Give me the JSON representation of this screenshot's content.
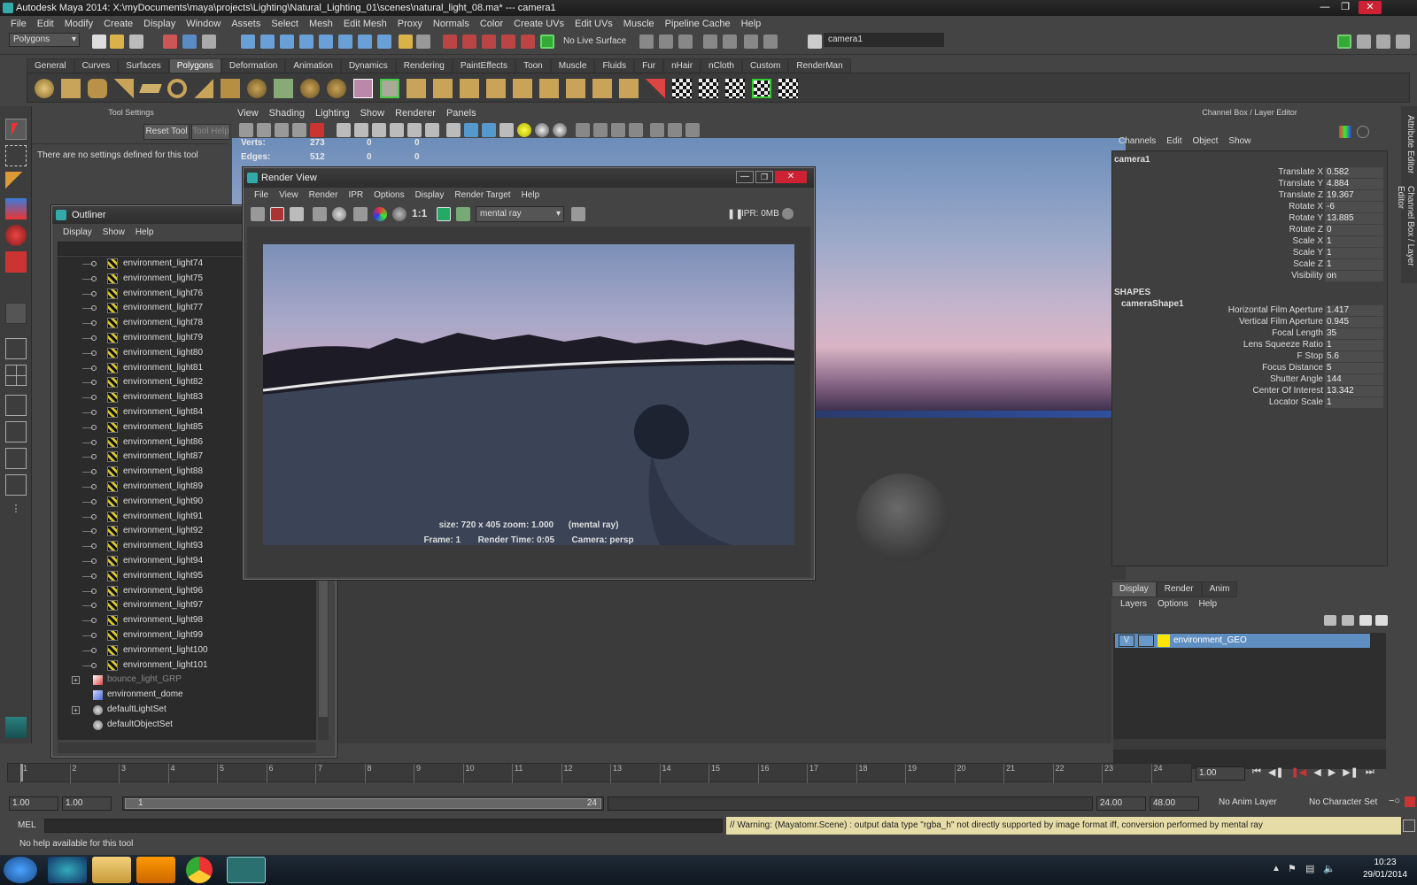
{
  "app": {
    "title": "Autodesk Maya 2014: X:\\myDocuments\\maya\\projects\\Lighting\\Natural_Lighting_01\\scenes\\natural_light_08.ma*   ---   camera1",
    "menus": [
      "File",
      "Edit",
      "Modify",
      "Create",
      "Display",
      "Window",
      "Assets",
      "Select",
      "Mesh",
      "Edit Mesh",
      "Proxy",
      "Normals",
      "Color",
      "Create UVs",
      "Edit UVs",
      "Muscle",
      "Pipeline Cache",
      "Help"
    ]
  },
  "statusline": {
    "menuset": "Polygons",
    "live_surface": "No Live Surface",
    "camera_field": "camera1"
  },
  "shelf": {
    "tabs": [
      "General",
      "Curves",
      "Surfaces",
      "Polygons",
      "Deformation",
      "Animation",
      "Dynamics",
      "Rendering",
      "PaintEffects",
      "Toon",
      "Muscle",
      "Fluids",
      "Fur",
      "nHair",
      "nCloth",
      "Custom",
      "RenderMan"
    ],
    "active_tab": "Polygons"
  },
  "tool_settings": {
    "header": "Tool Settings",
    "reset_label": "Reset Tool",
    "help_label": "Tool Help",
    "message": "There are no settings defined for this tool"
  },
  "viewport": {
    "menus": [
      "View",
      "Shading",
      "Lighting",
      "Show",
      "Renderer",
      "Panels"
    ],
    "hud": {
      "verts_label": "Verts:",
      "verts": [
        "273",
        "0",
        "0"
      ],
      "edges_label": "Edges:",
      "edges": [
        "512",
        "0",
        "0"
      ]
    }
  },
  "render_view": {
    "title": "Render View",
    "menus": [
      "File",
      "View",
      "Render",
      "IPR",
      "Options",
      "Display",
      "Render Target",
      "Help"
    ],
    "renderer": "mental ray",
    "ratio": "1:1",
    "ipr": "IPR: 0MB",
    "info1": "size: 720 x 405 zoom: 1.000      (mental ray)",
    "info2": "Frame: 1       Render Time: 0:05       Camera: persp"
  },
  "outliner": {
    "title": "Outliner",
    "menus": [
      "Display",
      "Show",
      "Help"
    ],
    "lights": [
      "environment_light74",
      "environment_light75",
      "environment_light76",
      "environment_light77",
      "environment_light78",
      "environment_light79",
      "environment_light80",
      "environment_light81",
      "environment_light82",
      "environment_light83",
      "environment_light84",
      "environment_light85",
      "environment_light86",
      "environment_light87",
      "environment_light88",
      "environment_light89",
      "environment_light90",
      "environment_light91",
      "environment_light92",
      "environment_light93",
      "environment_light94",
      "environment_light95",
      "environment_light96",
      "environment_light97",
      "environment_light98",
      "environment_light99",
      "environment_light100",
      "environment_light101"
    ],
    "other": [
      {
        "name": "bounce_light_GRP",
        "expand": true,
        "dim": true
      },
      {
        "name": "environment_dome",
        "expand": false,
        "dim": false
      },
      {
        "name": "defaultLightSet",
        "expand": true,
        "dim": false
      },
      {
        "name": "defaultObjectSet",
        "expand": false,
        "dim": false
      }
    ]
  },
  "channel_box": {
    "header": "Channel Box / Layer Editor",
    "menus": [
      "Channels",
      "Edit",
      "Object",
      "Show"
    ],
    "object": "camera1",
    "attrs": [
      {
        "k": "Translate X",
        "v": "0.582"
      },
      {
        "k": "Translate Y",
        "v": "4.884"
      },
      {
        "k": "Translate Z",
        "v": "19.367"
      },
      {
        "k": "Rotate X",
        "v": "-6"
      },
      {
        "k": "Rotate Y",
        "v": "13.885"
      },
      {
        "k": "Rotate Z",
        "v": "0"
      },
      {
        "k": "Scale X",
        "v": "1"
      },
      {
        "k": "Scale Y",
        "v": "1"
      },
      {
        "k": "Scale Z",
        "v": "1"
      },
      {
        "k": "Visibility",
        "v": "on"
      }
    ],
    "shapes_label": "SHAPES",
    "shape_name": "cameraShape1",
    "shape_attrs": [
      {
        "k": "Horizontal Film Aperture",
        "v": "1.417"
      },
      {
        "k": "Vertical Film Aperture",
        "v": "0.945"
      },
      {
        "k": "Focal Length",
        "v": "35"
      },
      {
        "k": "Lens Squeeze Ratio",
        "v": "1"
      },
      {
        "k": "F Stop",
        "v": "5.6"
      },
      {
        "k": "Focus Distance",
        "v": "5"
      },
      {
        "k": "Shutter Angle",
        "v": "144"
      },
      {
        "k": "Center Of Interest",
        "v": "13.342"
      },
      {
        "k": "Locator Scale",
        "v": "1"
      }
    ]
  },
  "layer_editor": {
    "tabs": [
      "Display",
      "Render",
      "Anim"
    ],
    "menus": [
      "Layers",
      "Options",
      "Help"
    ],
    "layer": {
      "visible": "V",
      "name": "environment_GEO"
    }
  },
  "side_tabs": [
    "Attribute Editor",
    "Channel Box / Layer Editor"
  ],
  "time_slider": {
    "ticks": [
      "1",
      "2",
      "3",
      "4",
      "5",
      "6",
      "7",
      "8",
      "9",
      "10",
      "11",
      "12",
      "13",
      "14",
      "15",
      "16",
      "17",
      "18",
      "19",
      "20",
      "21",
      "22",
      "23",
      "24"
    ],
    "current": "1.00"
  },
  "range": {
    "start": "1.00",
    "start2": "1.00",
    "range_start": "1",
    "range_end": "24",
    "end": "24.00",
    "end2": "48.00",
    "anim_layer": "No Anim Layer",
    "char_set": "No Character Set"
  },
  "command": {
    "label": "MEL",
    "warning": "// Warning: (Mayatomr.Scene) : output data type \"rgba_h\" not directly supported by image format iff, conversion performed by mental ray",
    "help": "No help available for this tool"
  },
  "taskbar": {
    "time": "10:23",
    "date": "29/01/2014"
  },
  "colors": {
    "bg": "#444444",
    "accent": "#5f8fc0",
    "warning_bg": "#e6dca8"
  }
}
